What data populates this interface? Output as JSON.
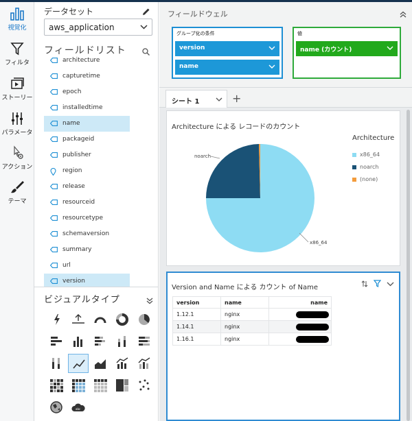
{
  "rail": {
    "items": [
      {
        "label": "視覚化",
        "icon": "bar-chart-icon",
        "active": true
      },
      {
        "label": "フィルタ",
        "icon": "funnel-icon"
      },
      {
        "label": "ストーリー",
        "icon": "story-icon"
      },
      {
        "label": "パラメータ",
        "icon": "sliders-icon"
      },
      {
        "label": "アクション",
        "icon": "pointer-gear-icon"
      },
      {
        "label": "テーマ",
        "icon": "paintbrush-icon"
      }
    ]
  },
  "dataset": {
    "title": "データセット",
    "selected": "aws_application"
  },
  "field_list": {
    "title": "フィールドリスト",
    "items": [
      {
        "name": "architecture",
        "type": "dimension"
      },
      {
        "name": "capturetime",
        "type": "dimension"
      },
      {
        "name": "epoch",
        "type": "dimension"
      },
      {
        "name": "installedtime",
        "type": "dimension"
      },
      {
        "name": "name",
        "type": "dimension",
        "selected": true
      },
      {
        "name": "packageid",
        "type": "dimension"
      },
      {
        "name": "publisher",
        "type": "dimension"
      },
      {
        "name": "region",
        "type": "geo"
      },
      {
        "name": "release",
        "type": "dimension"
      },
      {
        "name": "resourceid",
        "type": "dimension"
      },
      {
        "name": "resourcetype",
        "type": "dimension"
      },
      {
        "name": "schemaversion",
        "type": "dimension"
      },
      {
        "name": "summary",
        "type": "dimension"
      },
      {
        "name": "url",
        "type": "dimension"
      },
      {
        "name": "version",
        "type": "dimension",
        "selected": true
      }
    ]
  },
  "visual_types": {
    "title": "ビジュアルタイプ",
    "selected_index": 11
  },
  "field_well": {
    "title": "フィールドウェル",
    "group_by": {
      "label": "グループ化の条件",
      "fields": [
        "version",
        "name"
      ]
    },
    "value": {
      "label": "値",
      "fields": [
        "name (カウント)"
      ]
    }
  },
  "sheet": {
    "tab_label": "シート 1",
    "add_label": "+"
  },
  "pie_visual": {
    "title": "Architecture による レコードのカウント",
    "slice_labels": {
      "noarch": "noarch",
      "x86_64": "x86_64"
    },
    "legend": {
      "title": "Architecture",
      "items": [
        {
          "label": "x86_64",
          "color": "#8edcf3"
        },
        {
          "label": "noarch",
          "color": "#1a5276"
        },
        {
          "label": "(none)",
          "color": "#f39c3d"
        }
      ]
    }
  },
  "chart_data": {
    "type": "pie",
    "title": "Architecture による レコードのカウント",
    "categories": [
      "x86_64",
      "noarch",
      "(none)"
    ],
    "values": [
      75,
      24.6,
      0.4
    ],
    "colors": [
      "#8edcf3",
      "#1a5276",
      "#f39c3d"
    ],
    "legend": "right"
  },
  "table_visual": {
    "title": "Version and Name による カウント of Name",
    "columns": [
      "version",
      "name",
      "name"
    ],
    "rows": [
      {
        "version": "1.12.1",
        "name": "nginx"
      },
      {
        "version": "1.14.1",
        "name": "nginx"
      },
      {
        "version": "1.16.1",
        "name": "nginx"
      }
    ]
  }
}
